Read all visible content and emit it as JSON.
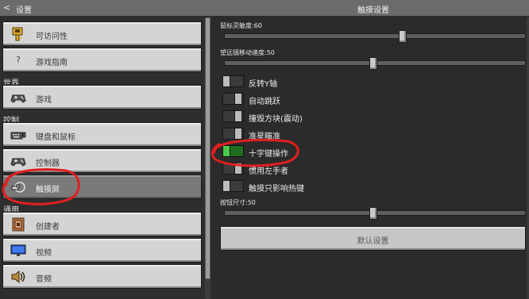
{
  "header": {
    "back_glyph": "<",
    "left_title": "设置",
    "center_title": "触摸设置"
  },
  "sidebar": {
    "sections": {
      "world": "世界",
      "controls": "控制",
      "general": "通用"
    },
    "items": [
      {
        "label": "可访问性",
        "icon": "key-icon"
      },
      {
        "label": "游戏指南",
        "icon": "question-icon",
        "glyph": "?"
      },
      {
        "label": "游戏",
        "icon": "gamepad-icon"
      },
      {
        "label": "键盘和鼠标",
        "icon": "keyboard-icon"
      },
      {
        "label": "控制器",
        "icon": "controller-icon"
      },
      {
        "label": "触摸屏",
        "icon": "touch-icon",
        "selected": true
      },
      {
        "label": "创建者",
        "icon": "creator-icon"
      },
      {
        "label": "视频",
        "icon": "monitor-icon"
      },
      {
        "label": "音频",
        "icon": "speaker-icon"
      }
    ]
  },
  "settings": {
    "mouse_sensitivity": {
      "label": "鼠标灵敏度:60",
      "value": 60
    },
    "telescope_speed": {
      "label": "望远镜移动速度:50",
      "value": 50
    },
    "toggles": [
      {
        "label": "反转Y轴",
        "on": false
      },
      {
        "label": "自动跳跃",
        "on": false
      },
      {
        "label": "撞毁方块(震动)",
        "on": false
      },
      {
        "label": "准星瞄准",
        "on": false
      },
      {
        "label": "十字键操作",
        "on": true
      },
      {
        "label": "惯用左手者",
        "on": false
      },
      {
        "label": "触摸只影响热键",
        "on": false
      }
    ],
    "button_size": {
      "label": "按钮尺寸:50",
      "value": 50
    },
    "reset_label": "默认设置"
  },
  "colors": {
    "annotation": "#e0201e",
    "toggle_on": "#4bc84b"
  }
}
